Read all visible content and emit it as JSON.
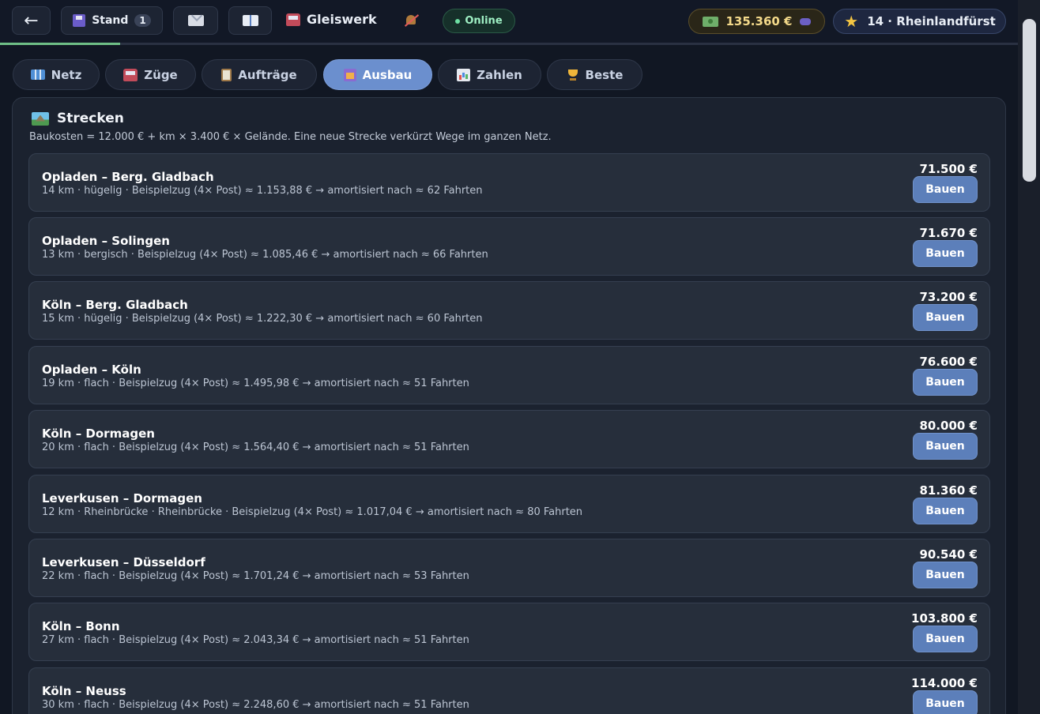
{
  "topbar": {
    "back_label": "←",
    "stand_label": "Stand",
    "stand_count": "1",
    "app_title": "Gleiswerk",
    "status": "Online",
    "money": "135.360 €",
    "level": "14 · Rheinlandfürst",
    "progress_percent": 11.8
  },
  "tabs": [
    {
      "label": "Netz",
      "icon": "map-icon"
    },
    {
      "label": "Züge",
      "icon": "train-icon"
    },
    {
      "label": "Aufträge",
      "icon": "clipboard-icon"
    },
    {
      "label": "Ausbau",
      "icon": "construction-icon",
      "active": true
    },
    {
      "label": "Zahlen",
      "icon": "chart-icon"
    },
    {
      "label": "Beste",
      "icon": "trophy-icon"
    }
  ],
  "panel": {
    "title": "Strecken",
    "subtitle": "Baukosten = 12.000 € + km × 3.400 € × Gelände. Eine neue Strecke verkürzt Wege im ganzen Netz.",
    "build_label": "Bauen",
    "routes": [
      {
        "name": "Opladen – Berg. Gladbach",
        "info": "14 km · hügelig · Beispielzug (4× Post) ≈ 1.153,88 € → amortisiert nach ≈ 62 Fahrten",
        "price": "71.500 €"
      },
      {
        "name": "Opladen – Solingen",
        "info": "13 km · bergisch · Beispielzug (4× Post) ≈ 1.085,46 € → amortisiert nach ≈ 66 Fahrten",
        "price": "71.670 €"
      },
      {
        "name": "Köln – Berg. Gladbach",
        "info": "15 km · hügelig · Beispielzug (4× Post) ≈ 1.222,30 € → amortisiert nach ≈ 60 Fahrten",
        "price": "73.200 €"
      },
      {
        "name": "Opladen – Köln",
        "info": "19 km · flach · Beispielzug (4× Post) ≈ 1.495,98 € → amortisiert nach ≈ 51 Fahrten",
        "price": "76.600 €"
      },
      {
        "name": "Köln – Dormagen",
        "info": "20 km · flach · Beispielzug (4× Post) ≈ 1.564,40 € → amortisiert nach ≈ 51 Fahrten",
        "price": "80.000 €"
      },
      {
        "name": "Leverkusen – Dormagen",
        "info": "12 km · Rheinbrücke · Rheinbrücke · Beispielzug (4× Post) ≈ 1.017,04 € → amortisiert nach ≈ 80 Fahrten",
        "price": "81.360 €"
      },
      {
        "name": "Leverkusen – Düsseldorf",
        "info": "22 km · flach · Beispielzug (4× Post) ≈ 1.701,24 € → amortisiert nach ≈ 53 Fahrten",
        "price": "90.540 €"
      },
      {
        "name": "Köln – Bonn",
        "info": "27 km · flach · Beispielzug (4× Post) ≈ 2.043,34 € → amortisiert nach ≈ 51 Fahrten",
        "price": "103.800 €"
      },
      {
        "name": "Köln – Neuss",
        "info": "30 km · flach · Beispielzug (4× Post) ≈ 2.248,60 € → amortisiert nach ≈ 51 Fahrten",
        "price": "114.000 €"
      }
    ]
  }
}
